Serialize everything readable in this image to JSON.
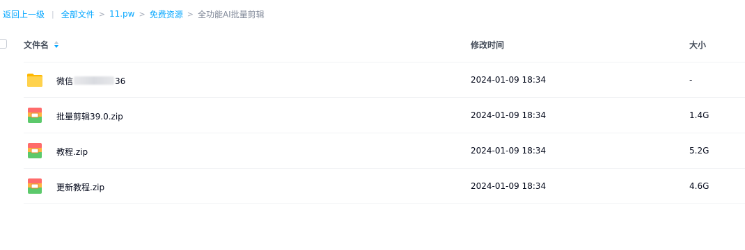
{
  "breadcrumb": {
    "back": "返回上一级",
    "divider": "|",
    "items": [
      "全部文件",
      "11.pw",
      "免费资源"
    ],
    "current": "全功能AI批量剪辑",
    "separator": ">"
  },
  "header": {
    "name_label": "文件名",
    "time_label": "修改时间",
    "size_label": "大小"
  },
  "files": [
    {
      "name_prefix": "微信",
      "name_suffix": "36",
      "name_redacted": true,
      "type": "folder-icon",
      "modified": "2024-01-09 18:34",
      "size": "-"
    },
    {
      "name": "批量剪辑39.0.zip",
      "type": "zip-icon",
      "modified": "2024-01-09 18:34",
      "size": "1.4G"
    },
    {
      "name": "教程.zip",
      "type": "zip-icon",
      "modified": "2024-01-09 18:34",
      "size": "5.2G"
    },
    {
      "name": "更新教程.zip",
      "type": "zip-icon",
      "modified": "2024-01-09 18:34",
      "size": "4.6G"
    }
  ],
  "colors": {
    "accent": "#06a7ff",
    "folder": "#ffc53d",
    "divider": "#f1f2f4"
  }
}
